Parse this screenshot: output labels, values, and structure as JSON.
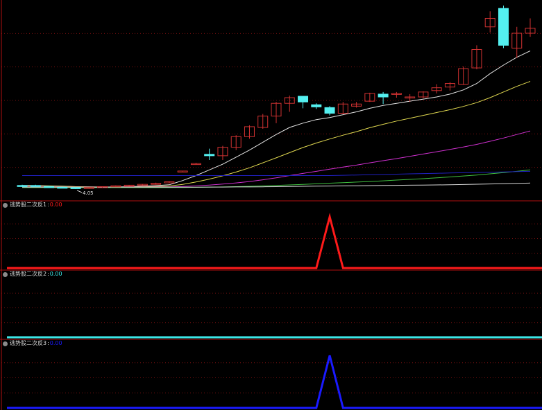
{
  "colors": {
    "background": "#000000",
    "grid": "#7a1010",
    "axis": "#b01010",
    "candle_up": "#d23232",
    "candle_down": "#54f0f0"
  },
  "main_panel": {
    "min_price_label": "4.05",
    "price_range": [
      3.9,
      17.2
    ]
  },
  "indicators": [
    {
      "name": "逃势股二次反1",
      "value": "0.00",
      "color": "#ff1a1a"
    },
    {
      "name": "逃势股二次反2",
      "value": "0.00",
      "color": "#3ce6e6"
    },
    {
      "name": "逃势股二次反3",
      "value": "0.00",
      "color": "#1a1aff"
    }
  ],
  "chart_data": [
    {
      "type": "candlestick",
      "title": "",
      "ylim": [
        3.9,
        17.2
      ],
      "grid": true,
      "candles": [
        {
          "o": 4.3,
          "h": 4.35,
          "l": 4.2,
          "c": 4.25
        },
        {
          "o": 4.3,
          "h": 4.35,
          "l": 4.22,
          "c": 4.24
        },
        {
          "o": 4.22,
          "h": 4.28,
          "l": 4.15,
          "c": 4.18
        },
        {
          "o": 4.18,
          "h": 4.22,
          "l": 4.12,
          "c": 4.15
        },
        {
          "o": 4.15,
          "h": 4.18,
          "l": 4.05,
          "c": 4.08
        },
        {
          "o": 4.1,
          "h": 4.18,
          "l": 4.08,
          "c": 4.16
        },
        {
          "o": 4.16,
          "h": 4.24,
          "l": 4.14,
          "c": 4.22
        },
        {
          "o": 4.22,
          "h": 4.3,
          "l": 4.2,
          "c": 4.28
        },
        {
          "o": 4.28,
          "h": 4.34,
          "l": 4.26,
          "c": 4.32
        },
        {
          "o": 4.32,
          "h": 4.4,
          "l": 4.3,
          "c": 4.38
        },
        {
          "o": 4.38,
          "h": 4.5,
          "l": 4.36,
          "c": 4.46
        },
        {
          "o": 4.52,
          "h": 4.6,
          "l": 4.46,
          "c": 4.56
        },
        {
          "o": 5.32,
          "h": 5.34,
          "l": 5.28,
          "c": 5.32
        },
        {
          "o": 5.85,
          "h": 5.9,
          "l": 5.8,
          "c": 5.85
        },
        {
          "o": 6.5,
          "h": 6.9,
          "l": 6.1,
          "c": 6.4
        },
        {
          "o": 6.4,
          "h": 7.1,
          "l": 6.1,
          "c": 7.0
        },
        {
          "o": 7.0,
          "h": 7.85,
          "l": 6.8,
          "c": 7.75
        },
        {
          "o": 7.75,
          "h": 8.55,
          "l": 7.6,
          "c": 8.45
        },
        {
          "o": 8.4,
          "h": 9.35,
          "l": 8.3,
          "c": 9.2
        },
        {
          "o": 9.2,
          "h": 10.2,
          "l": 8.7,
          "c": 10.1
        },
        {
          "o": 10.1,
          "h": 10.65,
          "l": 9.5,
          "c": 10.5
        },
        {
          "o": 10.6,
          "h": 10.6,
          "l": 9.75,
          "c": 10.2
        },
        {
          "o": 10.0,
          "h": 10.1,
          "l": 9.7,
          "c": 9.85
        },
        {
          "o": 9.8,
          "h": 9.9,
          "l": 9.25,
          "c": 9.4
        },
        {
          "o": 9.4,
          "h": 10.2,
          "l": 9.35,
          "c": 10.05
        },
        {
          "o": 9.9,
          "h": 10.2,
          "l": 9.8,
          "c": 10.05
        },
        {
          "o": 10.25,
          "h": 10.85,
          "l": 10.2,
          "c": 10.8
        },
        {
          "o": 10.75,
          "h": 10.9,
          "l": 10.05,
          "c": 10.55
        },
        {
          "o": 10.8,
          "h": 10.9,
          "l": 10.5,
          "c": 10.8
        },
        {
          "o": 10.5,
          "h": 10.75,
          "l": 10.2,
          "c": 10.55
        },
        {
          "o": 10.55,
          "h": 10.95,
          "l": 10.45,
          "c": 10.9
        },
        {
          "o": 11.0,
          "h": 11.45,
          "l": 10.8,
          "c": 11.2
        },
        {
          "o": 11.25,
          "h": 11.6,
          "l": 11.0,
          "c": 11.5
        },
        {
          "o": 11.45,
          "h": 12.7,
          "l": 11.4,
          "c": 12.55
        },
        {
          "o": 12.6,
          "h": 14.2,
          "l": 12.5,
          "c": 13.9
        },
        {
          "o": 15.5,
          "h": 16.6,
          "l": 15.1,
          "c": 16.1
        },
        {
          "o": 16.8,
          "h": 17.0,
          "l": 14.0,
          "c": 14.2
        },
        {
          "o": 14.0,
          "h": 15.5,
          "l": 13.3,
          "c": 15.05
        },
        {
          "o": 15.05,
          "h": 16.1,
          "l": 14.8,
          "c": 15.4
        }
      ],
      "series": [
        {
          "values": [
            4.3,
            4.29,
            4.27,
            4.25,
            4.22,
            4.2,
            4.19,
            4.2,
            4.22,
            4.25,
            4.29,
            4.35,
            4.65,
            5.0,
            5.4,
            5.8,
            6.3,
            6.8,
            7.35,
            7.9,
            8.4,
            8.7,
            8.95,
            9.1,
            9.3,
            9.5,
            9.75,
            9.95,
            10.1,
            10.25,
            10.4,
            10.55,
            10.75,
            11.05,
            11.5,
            12.2,
            12.8,
            13.35,
            13.8
          ],
          "color": "#e6e6e6"
        },
        {
          "values": [
            4.25,
            4.25,
            4.25,
            4.24,
            4.22,
            4.21,
            4.2,
            4.2,
            4.2,
            4.21,
            4.23,
            4.26,
            4.38,
            4.55,
            4.75,
            4.98,
            5.25,
            5.55,
            5.9,
            6.25,
            6.62,
            6.98,
            7.3,
            7.58,
            7.85,
            8.1,
            8.38,
            8.62,
            8.85,
            9.05,
            9.25,
            9.45,
            9.65,
            9.88,
            10.15,
            10.5,
            10.9,
            11.3,
            11.65
          ],
          "color": "#e0d850"
        },
        {
          "values": [
            4.2,
            4.2,
            4.2,
            4.2,
            4.19,
            4.19,
            4.19,
            4.19,
            4.19,
            4.19,
            4.2,
            4.2,
            4.23,
            4.27,
            4.33,
            4.4,
            4.48,
            4.58,
            4.7,
            4.84,
            5.0,
            5.15,
            5.3,
            5.45,
            5.6,
            5.74,
            5.9,
            6.05,
            6.2,
            6.36,
            6.52,
            6.68,
            6.85,
            7.02,
            7.2,
            7.42,
            7.65,
            7.9,
            8.15
          ],
          "color": "#d030d0"
        },
        {
          "values": [
            4.15,
            4.15,
            4.15,
            4.15,
            4.15,
            4.15,
            4.15,
            4.15,
            4.15,
            4.15,
            4.15,
            4.15,
            4.16,
            4.17,
            4.18,
            4.2,
            4.22,
            4.24,
            4.27,
            4.3,
            4.34,
            4.38,
            4.42,
            4.46,
            4.5,
            4.54,
            4.58,
            4.63,
            4.68,
            4.73,
            4.78,
            4.84,
            4.9,
            4.97,
            5.04,
            5.12,
            5.21,
            5.3,
            5.4
          ],
          "color": "#40c040"
        },
        {
          "values": [
            4.18,
            4.18,
            4.18,
            4.18,
            4.18,
            4.18,
            4.18,
            4.18,
            4.18,
            4.18,
            4.18,
            4.18,
            4.18,
            4.18,
            4.19,
            4.19,
            4.2,
            4.2,
            4.21,
            4.22,
            4.23,
            4.24,
            4.25,
            4.26,
            4.27,
            4.28,
            4.29,
            4.3,
            4.31,
            4.32,
            4.33,
            4.34,
            4.35,
            4.37,
            4.39,
            4.41,
            4.43,
            4.45,
            4.47
          ],
          "color": "#d8d8d8"
        },
        {
          "values": [
            5.0,
            5.0,
            5.0,
            5.0,
            5.0,
            5.0,
            5.0,
            5.0,
            5.0,
            5.0,
            5.0,
            5.0,
            5.0,
            5.0,
            5.0,
            5.0,
            5.0,
            5.0,
            5.0,
            5.0,
            5.0,
            5.0,
            5.0,
            5.0,
            5.02,
            5.04,
            5.06,
            5.08,
            5.1,
            5.12,
            5.14,
            5.16,
            5.18,
            5.2,
            5.22,
            5.24,
            5.26,
            5.28,
            5.3
          ],
          "color": "#2020c0"
        }
      ]
    },
    {
      "type": "line",
      "ylim": [
        0,
        1.15
      ],
      "values": [
        0,
        0,
        0,
        0,
        0,
        0,
        0,
        0,
        0,
        0,
        0,
        0,
        0,
        0,
        0,
        0,
        0,
        0,
        0,
        0,
        0,
        0,
        0,
        1,
        0,
        0,
        0,
        0,
        0,
        0,
        0,
        0,
        0,
        0,
        0,
        0,
        0,
        0,
        0
      ],
      "color": "#ff1a1a"
    },
    {
      "type": "line",
      "ylim": [
        0,
        1.15
      ],
      "values": [
        0,
        0,
        0,
        0,
        0,
        0,
        0,
        0,
        0,
        0,
        0,
        0,
        0,
        0,
        0,
        0,
        0,
        0,
        0,
        0,
        0,
        0,
        0,
        0,
        0,
        0,
        0,
        0,
        0,
        0,
        0,
        0,
        0,
        0,
        0,
        0,
        0,
        0,
        0
      ],
      "color": "#3ce6e6"
    },
    {
      "type": "line",
      "ylim": [
        0,
        1.15
      ],
      "values": [
        0,
        0,
        0,
        0,
        0,
        0,
        0,
        0,
        0,
        0,
        0,
        0,
        0,
        0,
        0,
        0,
        0,
        0,
        0,
        0,
        0,
        0,
        0,
        1,
        0,
        0,
        0,
        0,
        0,
        0,
        0,
        0,
        0,
        0,
        0,
        0,
        0,
        0,
        0
      ],
      "color": "#1a1aff"
    }
  ]
}
